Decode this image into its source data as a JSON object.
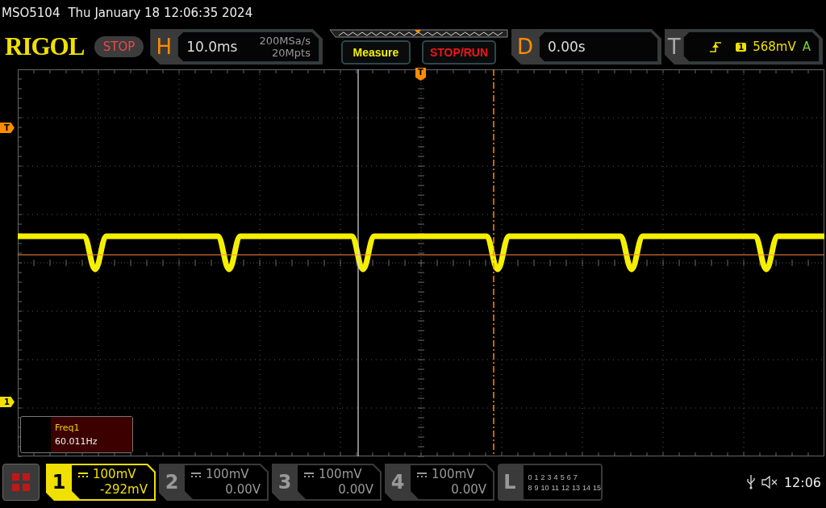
{
  "status_line": {
    "model": "MSO5104",
    "datetime": "Thu January 18 12:06:35 2024"
  },
  "logo": "RIGOL",
  "run_state": "STOP",
  "horizontal": {
    "label": "H",
    "timebase": "10.0ms",
    "sample_rate": "200MSa/s",
    "memory_depth": "20Mpts"
  },
  "buttons": [
    {
      "label": "Measure",
      "kind": "measure"
    },
    {
      "label": "STOP/RUN",
      "kind": "stoprun"
    }
  ],
  "delay": {
    "label": "D",
    "value": "0.00s"
  },
  "trigger": {
    "label": "T",
    "source": "1",
    "level": "568mV",
    "mode": "A"
  },
  "screen_markers": {
    "trigger_position": "T",
    "trigger_level": "T",
    "channel": "1"
  },
  "measurements": [
    {
      "name": "Freq1",
      "value": "60.011Hz"
    }
  ],
  "channels": [
    {
      "number": "1",
      "scale": "100mV",
      "offset": "-292mV",
      "selected": true
    },
    {
      "number": "2",
      "scale": "100mV",
      "offset": "0.00V",
      "selected": false
    },
    {
      "number": "3",
      "scale": "100mV",
      "offset": "0.00V",
      "selected": false
    },
    {
      "number": "4",
      "scale": "100mV",
      "offset": "0.00V",
      "selected": false
    }
  ],
  "logic": {
    "label": "L",
    "row_1": [
      "0",
      "1",
      "2",
      "3",
      "4",
      "5",
      "6",
      "7"
    ],
    "row_2": [
      "8",
      "9",
      "10",
      "11",
      "12",
      "13",
      "14",
      "15"
    ]
  },
  "clock": "12:06"
}
